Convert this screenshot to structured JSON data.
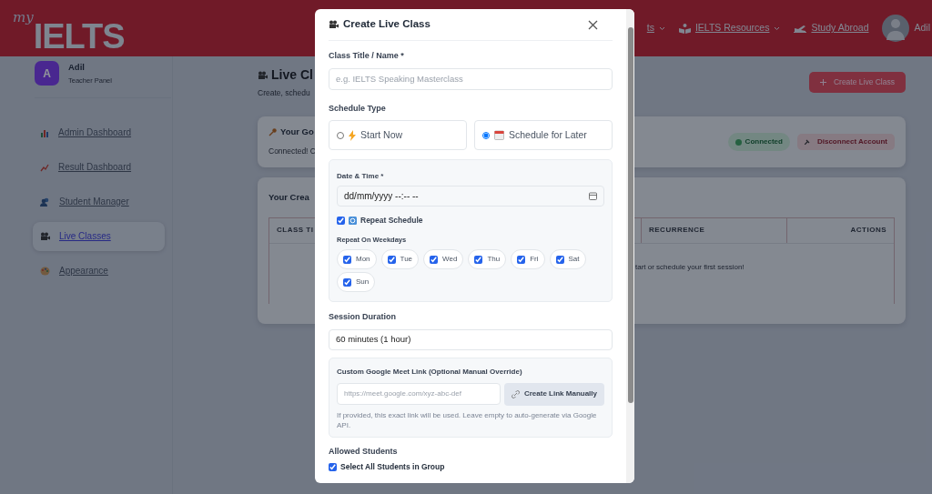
{
  "navbar": {
    "logo": {
      "script": "my",
      "text": "IELTS"
    },
    "items": [
      {
        "label": "ts",
        "dropdown": true
      },
      {
        "label": "IELTS Resources",
        "dropdown": true
      },
      {
        "label": "Study Abroad",
        "dropdown": false
      }
    ],
    "user": {
      "name": "Adil"
    }
  },
  "sidebar": {
    "profile": {
      "initial": "A",
      "name": "Adil",
      "role": "Teacher Panel"
    },
    "items": [
      {
        "label": "Admin Dashboard",
        "selected": false
      },
      {
        "label": "Result Dashboard",
        "selected": false
      },
      {
        "label": "Student Manager",
        "selected": false
      },
      {
        "label": "Live Classes",
        "selected": true
      },
      {
        "label": "Appearance",
        "selected": false
      }
    ]
  },
  "main": {
    "title": "Live Cl",
    "subtitle": "Create, schedu",
    "create_button": "Create Live Class",
    "google_card": {
      "title": "Your Go",
      "text": "Connected! C",
      "status": "Connected",
      "disconnect": "Disconnect Account"
    },
    "classes_card": {
      "title": "Your Crea",
      "columns": [
        "CLASS TI",
        "RECURRENCE",
        "ACTIONS"
      ],
      "empty": "tart or schedule your first session!"
    }
  },
  "modal": {
    "title": "Create Live Class",
    "class_title": {
      "label": "Class Title / Name *",
      "placeholder": "e.g. IELTS Speaking Masterclass"
    },
    "schedule_type": {
      "label": "Schedule Type",
      "options": [
        {
          "label": "Start Now",
          "selected": false
        },
        {
          "label": "Schedule for Later",
          "selected": true
        }
      ]
    },
    "date_time": {
      "label": "Date & Time *",
      "placeholder": "dd/mm/yyyy --:-- --"
    },
    "repeat": {
      "label": "Repeat Schedule",
      "checked": true
    },
    "weekdays": {
      "label": "Repeat On Weekdays",
      "days": [
        {
          "label": "Mon",
          "checked": true
        },
        {
          "label": "Tue",
          "checked": true
        },
        {
          "label": "Wed",
          "checked": true
        },
        {
          "label": "Thu",
          "checked": true
        },
        {
          "label": "Fri",
          "checked": true
        },
        {
          "label": "Sat",
          "checked": true
        },
        {
          "label": "Sun",
          "checked": true
        }
      ]
    },
    "duration": {
      "label": "Session Duration",
      "value": "60 minutes (1 hour)"
    },
    "custom_link": {
      "label": "Custom Google Meet Link (Optional Manual Override)",
      "placeholder": "https://meet.google.com/xyz-abc-def",
      "button": "Create Link Manually",
      "help": "If provided, this exact link will be used. Leave empty to auto-generate via Google API."
    },
    "students": {
      "label": "Allowed Students",
      "select_all": {
        "label": "Select All Students in Group",
        "checked": true
      }
    }
  }
}
